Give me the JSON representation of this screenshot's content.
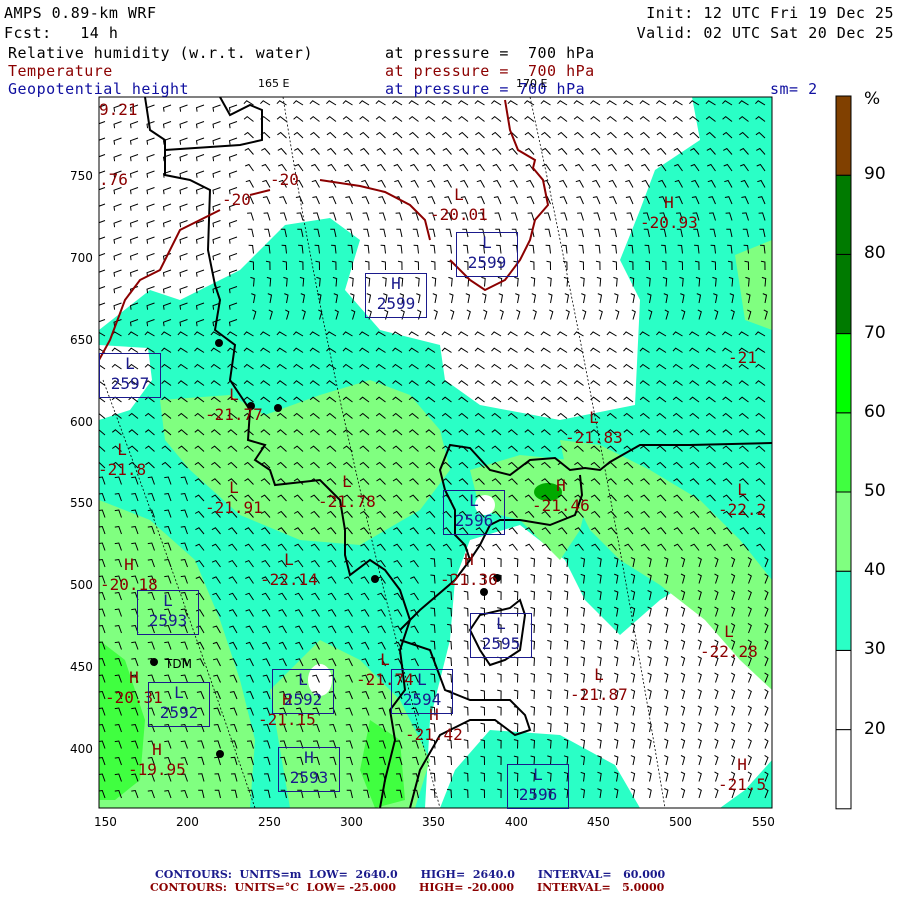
{
  "header": {
    "model": "AMPS 0.89-km WRF",
    "forecast": "Fcst:   14 h",
    "init": "Init: 12 UTC Fri 19 Dec 25",
    "valid": "Valid: 02 UTC Sat 20 Dec 25",
    "fields": [
      {
        "name": "Relative humidity (w.r.t. water)",
        "level": "at pressure =  700 hPa"
      },
      {
        "name": "Temperature",
        "level": "at pressure =  700 hPa"
      },
      {
        "name": "Geopotential height",
        "level": "at pressure = 700 hPa"
      }
    ],
    "smoothing": "sm= 2",
    "meridian_labels": [
      "165 E",
      "170 E"
    ]
  },
  "axes": {
    "x_ticks": [
      "150",
      "200",
      "250",
      "300",
      "350",
      "400",
      "450",
      "500",
      "550"
    ],
    "y_ticks": [
      "750",
      "700",
      "650",
      "600",
      "550",
      "500",
      "450",
      "400"
    ]
  },
  "colorbar": {
    "unit": "%",
    "labels": [
      "90",
      "80",
      "70",
      "60",
      "50",
      "40",
      "30",
      "20"
    ],
    "colors": [
      "#ffffff",
      "#ffffff",
      "#2affc6",
      "#80ff80",
      "#40ff40",
      "#00ff00",
      "#007a00",
      "#007a00",
      "#804000"
    ]
  },
  "colors": {
    "temp": "#8b0000",
    "height": "#1a1a8c",
    "rh_30_40": "#2affc6",
    "rh_40_50": "#80ff80",
    "rh_50_60": "#40ff40"
  },
  "temperature_labels": [
    {
      "sym": "",
      "val": "9.21"
    },
    {
      "sym": "",
      "val": ".76"
    },
    {
      "sym": "",
      "val": "-20"
    },
    {
      "sym": "",
      "val": "-20"
    },
    {
      "sym": "L",
      "val": "-20.01"
    },
    {
      "sym": "H",
      "val": "-20.93"
    },
    {
      "sym": "L",
      "val": "-21.77"
    },
    {
      "sym": "",
      "val": "-21"
    },
    {
      "sym": "L",
      "val": "-21.83"
    },
    {
      "sym": "L",
      "val": "-21.8"
    },
    {
      "sym": "L",
      "val": "-21.91"
    },
    {
      "sym": "L",
      "val": "-21.78"
    },
    {
      "sym": "H",
      "val": "-21.46"
    },
    {
      "sym": "L",
      "val": "-22.2"
    },
    {
      "sym": "H",
      "val": "-20.18"
    },
    {
      "sym": "L",
      "val": "-22.14"
    },
    {
      "sym": "H",
      "val": "-21.36"
    },
    {
      "sym": "L",
      "val": "-21.74"
    },
    {
      "sym": "L",
      "val": "-22.28"
    },
    {
      "sym": "H",
      "val": "-20.31"
    },
    {
      "sym": "L",
      "val": "-21.87"
    },
    {
      "sym": "H",
      "val": "-21.15"
    },
    {
      "sym": "H",
      "val": "-21.42"
    },
    {
      "sym": "H",
      "val": "-19.95"
    },
    {
      "sym": "H",
      "val": "-21.5"
    }
  ],
  "height_labels": [
    {
      "sym": "L",
      "val": "2597"
    },
    {
      "sym": "H",
      "val": "2599"
    },
    {
      "sym": "L",
      "val": "2599"
    },
    {
      "sym": "L",
      "val": "2596"
    },
    {
      "sym": "L",
      "val": "2593"
    },
    {
      "sym": "L",
      "val": "2592"
    },
    {
      "sym": "L",
      "val": "2592"
    },
    {
      "sym": "L",
      "val": "2595"
    },
    {
      "sym": "L",
      "val": "2594"
    },
    {
      "sym": "H",
      "val": "2593"
    },
    {
      "sym": "L",
      "val": "2596"
    }
  ],
  "stations": [
    {
      "name": "TDM"
    }
  ],
  "footer": {
    "height_contours": "CONTOURS:  UNITS=m  LOW=  2640.0      HIGH=  2640.0      INTERVAL=   60.000",
    "temp_contours": "CONTOURS:  UNITS=°C  LOW= -25.000      HIGH= -20.000      INTERVAL=   5.0000"
  }
}
